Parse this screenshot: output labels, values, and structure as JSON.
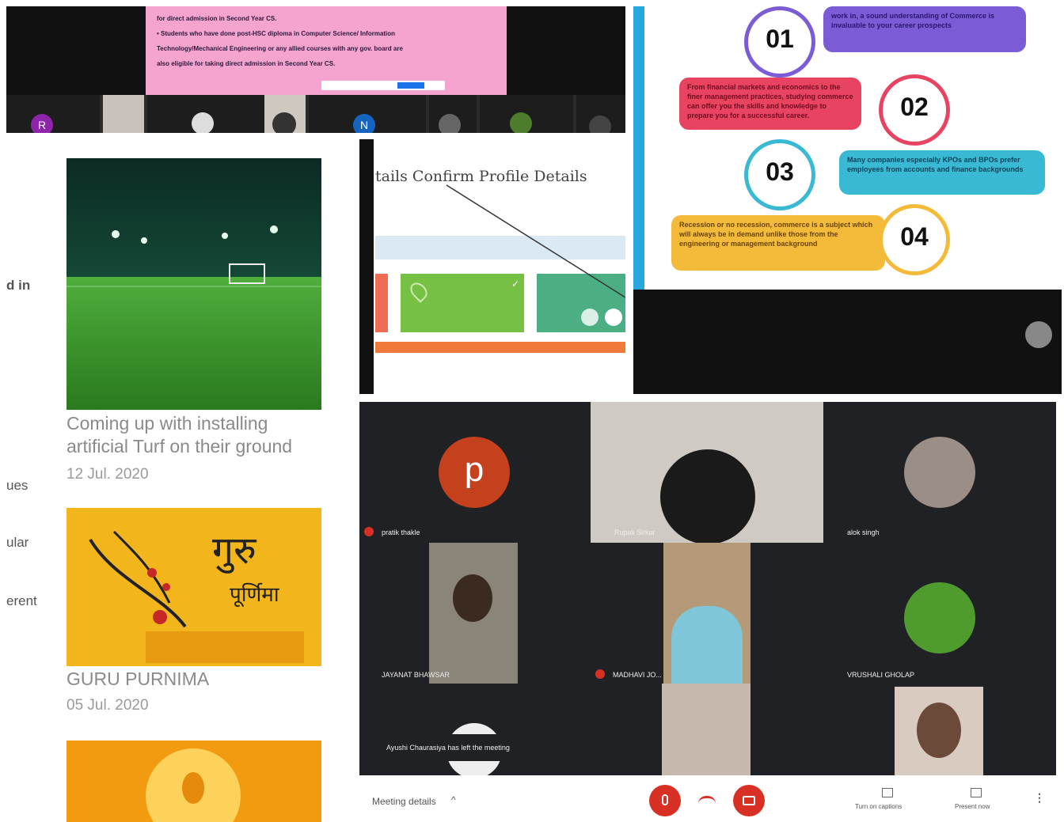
{
  "top_meeting": {
    "slide_lines": [
      "for direct admission in Second Year CS.",
      "• Students who have done post-HSC diploma in Computer Science/ Information",
      "Technology/Mechanical Engineering or any allied courses with any gov. board are",
      "also eligible for taking direct admission in Second Year CS."
    ],
    "avatars": [
      "R",
      "N"
    ]
  },
  "website": {
    "cut_texts": [
      "d in",
      "ues",
      "ular",
      "erent"
    ],
    "news": [
      {
        "title_line1": "Coming up with installing",
        "title_line2": "artificial Turf on their ground",
        "date": "12 Jul. 2020"
      },
      {
        "title_line1": "GURU PURNIMA",
        "title_line2": "",
        "date": "05 Jul. 2020"
      }
    ],
    "guru_purnima_art": [
      "गुरु",
      "पूर्णिमा"
    ]
  },
  "profile_slide": {
    "heading": "tails Confirm Profile Details"
  },
  "infographic": {
    "steps": [
      {
        "num": "01",
        "text": "work in, a sound understanding of Commerce is invaluable to your career prospects"
      },
      {
        "num": "02",
        "text": "From financial markets and economics to the finer management practices, studying commerce can offer you the skills and knowledge to prepare you for a successful career."
      },
      {
        "num": "03",
        "text": "Many companies especially KPOs and BPOs prefer employees from accounts and finance backgrounds"
      },
      {
        "num": "04",
        "text": "Recession or no recession, commerce is a subject which will always be in demand unlike those from the engineering or management background"
      }
    ]
  },
  "meeting": {
    "participants": [
      {
        "name": "pratik thakle",
        "avatar": "p"
      },
      {
        "name": "Rupali Sirkar"
      },
      {
        "name": "alok singh"
      },
      {
        "name": "JAYANAT BHAWSAR"
      },
      {
        "name": "MADHAVI JO..."
      },
      {
        "name": "VRUSHALI GHOLAP"
      }
    ],
    "notification": "Ayushi Chaurasiya has left the meeting",
    "meeting_details": "Meeting details",
    "captions": "Turn on captions",
    "present": "Present now",
    "colors": {
      "end_call": "#d93025",
      "avatar_p": "#c5411e",
      "dark": "#202124"
    }
  }
}
